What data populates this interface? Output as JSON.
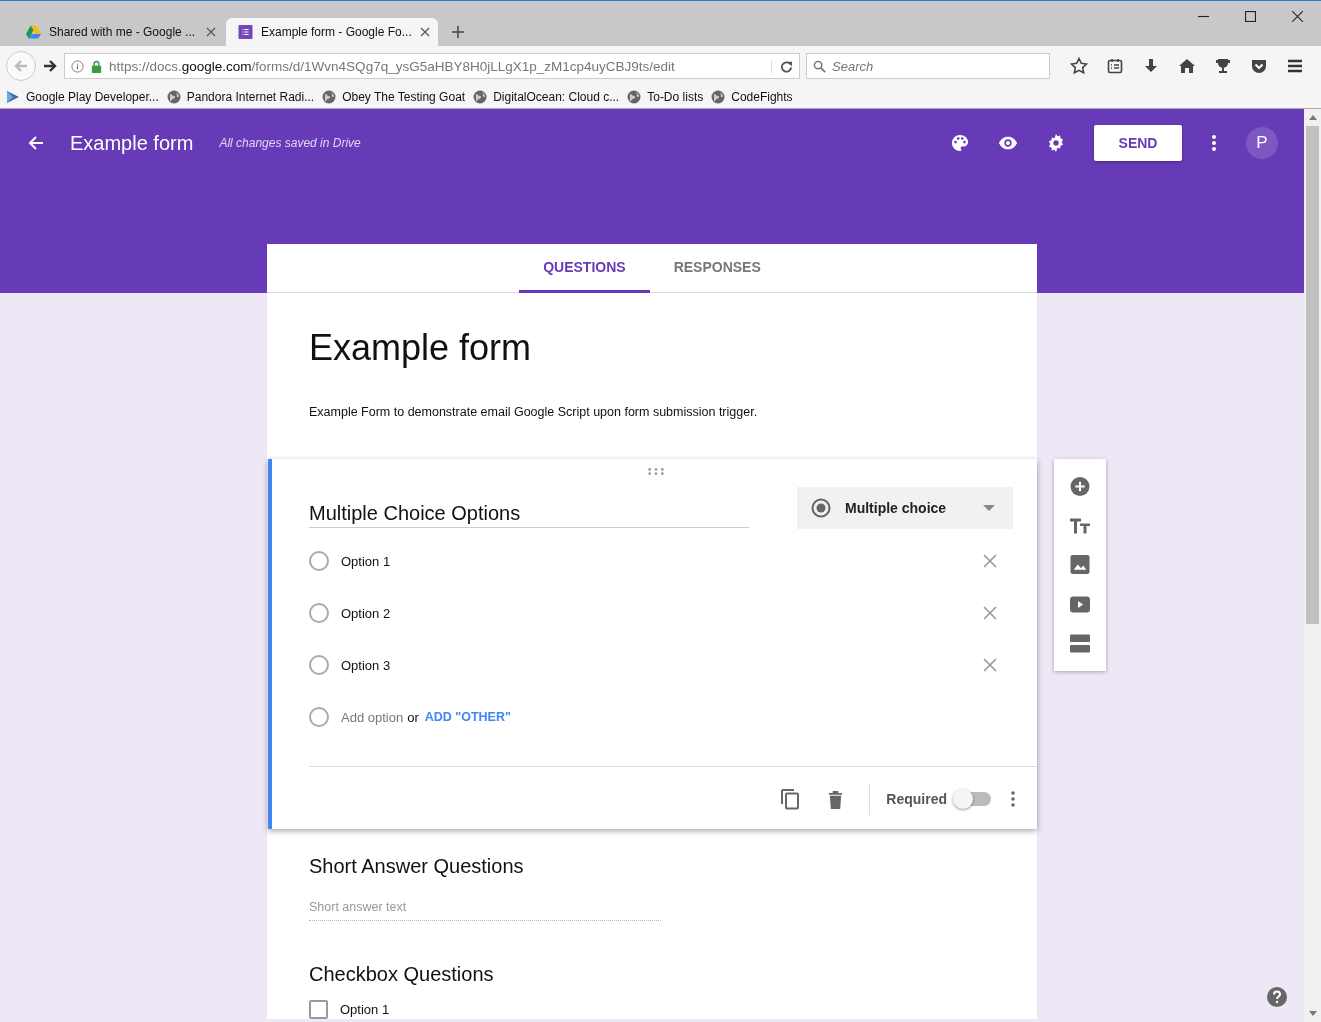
{
  "browser": {
    "tabs": [
      {
        "title": "Shared with me - Google ...",
        "selected": false
      },
      {
        "title": "Example form - Google Fo...",
        "selected": true
      }
    ],
    "url": {
      "scheme": "https://docs.",
      "domain": "google.com",
      "path": "/forms/d/1Wvn4SQg7q_ysG5aHBY8H0jLLgX1p_zM1cp4uyCBJ9ts/edit"
    },
    "search": {
      "placeholder": "Search"
    },
    "bookmarks": [
      "Google Play Developer...",
      "Pandora Internet Radi...",
      "Obey The Testing Goat",
      "DigitalOcean: Cloud c...",
      "To-Do lists",
      "CodeFights"
    ]
  },
  "app_bar": {
    "title": "Example form",
    "status": "All changes saved in Drive",
    "send": "SEND",
    "avatar": "P"
  },
  "tabs": [
    {
      "label": "QUESTIONS",
      "selected": true
    },
    {
      "label": "RESPONSES",
      "selected": false
    }
  ],
  "form": {
    "title": "Example form",
    "description": "Example Form to demonstrate email Google Script upon form submission trigger."
  },
  "question": {
    "title": "Multiple Choice Options",
    "type": "Multiple choice",
    "options": [
      {
        "label": "Option 1",
        "selected": false
      },
      {
        "label": "Option 2",
        "selected": false
      },
      {
        "label": "Option 3",
        "selected": false
      }
    ],
    "add_option": {
      "label": "Add option",
      "selected": false
    },
    "or": "or",
    "add_other": "ADD \"OTHER\"",
    "required": {
      "label": "Required",
      "on": false
    }
  },
  "questions": [
    {
      "kind": "short_answer",
      "title": "Short Answer Questions",
      "placeholder": "Short answer text"
    },
    {
      "kind": "checkbox",
      "title": "Checkbox Questions",
      "options": [
        {
          "label": "Option 1",
          "checked": false
        }
      ]
    }
  ]
}
